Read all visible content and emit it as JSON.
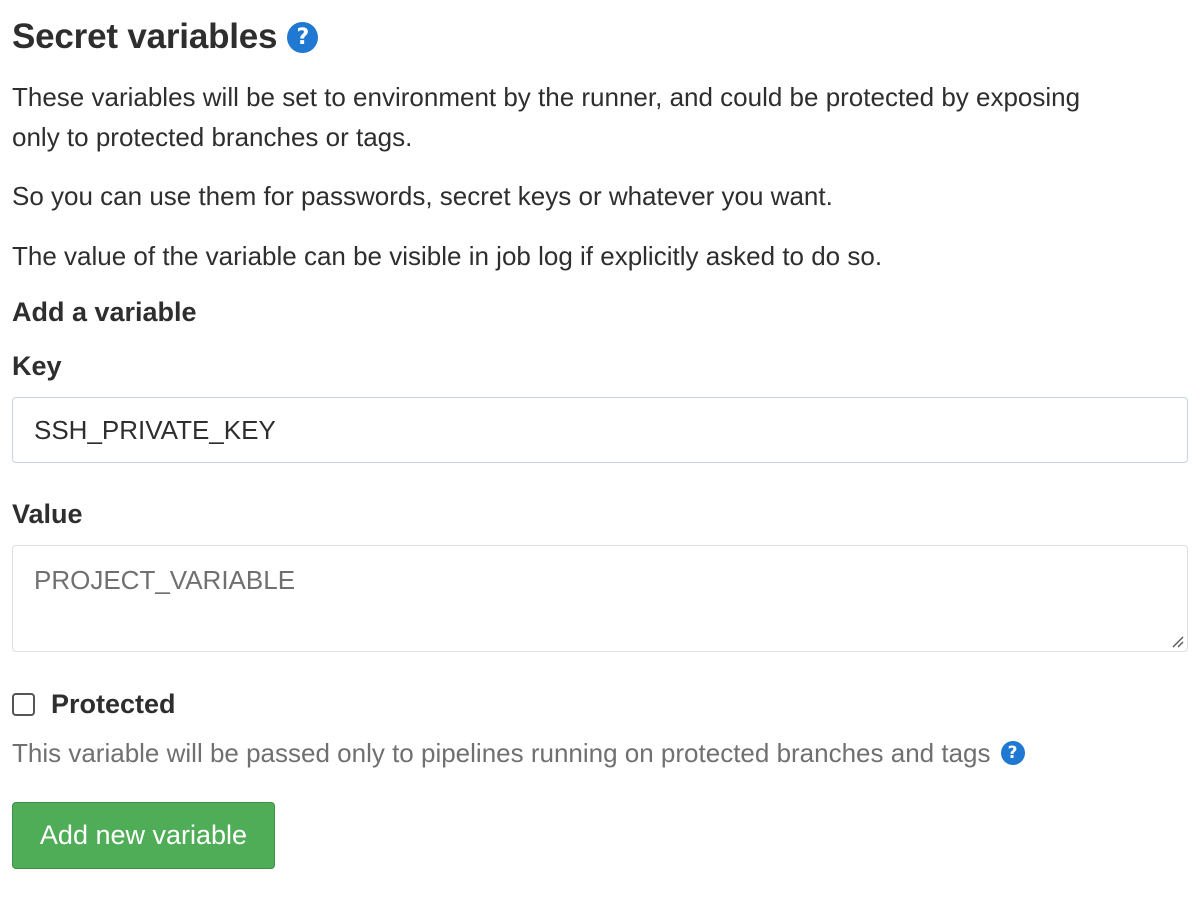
{
  "header": {
    "title": "Secret variables",
    "help_icon": "question-circle-icon"
  },
  "description": {
    "paragraph1": "These variables will be set to environment by the runner, and could be protected by exposing only to protected branches or tags.",
    "paragraph2": "So you can use them for passwords, secret keys or whatever you want.",
    "paragraph3": "The value of the variable can be visible in job log if explicitly asked to do so."
  },
  "form": {
    "heading": "Add a variable",
    "key_label": "Key",
    "key_value": "SSH_PRIVATE_KEY",
    "value_label": "Value",
    "value_placeholder": "PROJECT_VARIABLE",
    "protected_label": "Protected",
    "protected_checked": false,
    "protected_help": "This variable will be passed only to pipelines running on protected branches and tags",
    "submit_label": "Add new variable"
  },
  "colors": {
    "accent_blue": "#1f78d1",
    "button_green": "#4fad57"
  }
}
